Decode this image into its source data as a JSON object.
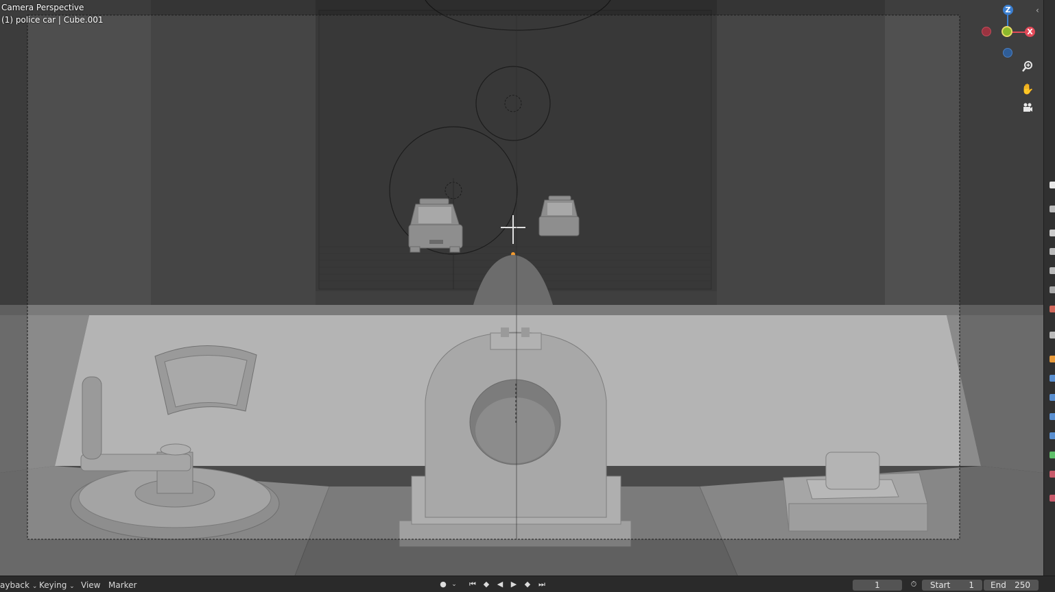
{
  "viewport": {
    "overlay_line1": "Camera Perspective",
    "overlay_line2": "(1) police car | Cube.001"
  },
  "gizmo": {
    "z_label": "Z",
    "x_label": "X",
    "colors": {
      "x": "#e34a59",
      "y": "#8cb82c",
      "z": "#3b7fd1"
    }
  },
  "nav_icons": [
    "zoom-icon",
    "hand-pan-icon",
    "camera-view-icon"
  ],
  "timeline": {
    "menu_playback": "ayback",
    "menu_keying": "Keying",
    "menu_view": "View",
    "menu_marker": "Marker",
    "current_frame": "1",
    "start_label": "Start",
    "start_value": "1",
    "end_label": "End",
    "end_value": "250"
  }
}
